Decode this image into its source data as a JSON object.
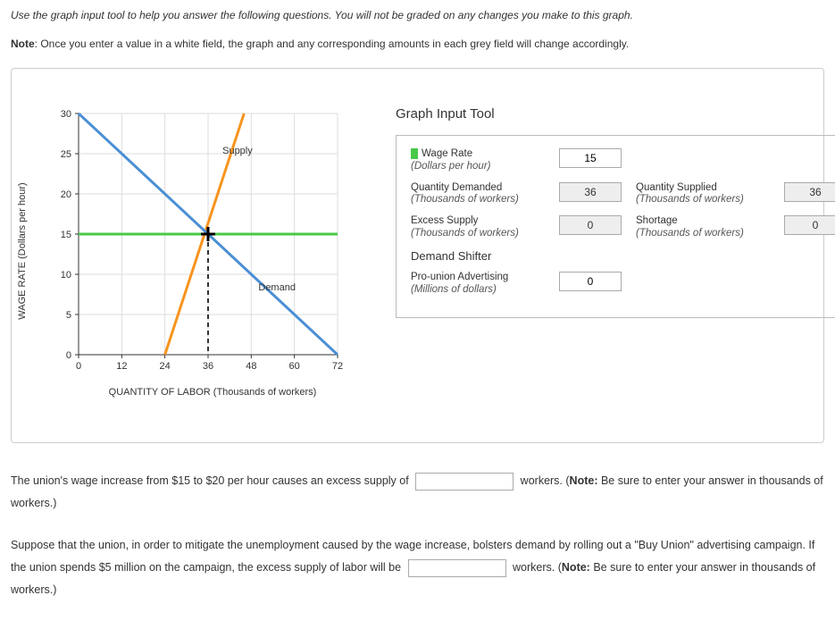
{
  "intro": "Use the graph input tool to help you answer the following questions. You will not be graded on any changes you make to this graph.",
  "note_prefix": "Note",
  "note_body": ": Once you enter a value in a white field, the graph and any corresponding amounts in each grey field will change accordingly.",
  "tool_title": "Graph Input Tool",
  "demand_shifter_heading": "Demand Shifter",
  "fields": {
    "wage_rate": {
      "label": "Wage Rate",
      "sub": "(Dollars per hour)",
      "value": "15"
    },
    "qty_demanded": {
      "label": "Quantity Demanded",
      "sub": "(Thousands of workers)",
      "value": "36"
    },
    "qty_supplied": {
      "label": "Quantity Supplied",
      "sub": "(Thousands of workers)",
      "value": "36"
    },
    "excess_supply": {
      "label": "Excess Supply",
      "sub": "(Thousands of workers)",
      "value": "0"
    },
    "shortage": {
      "label": "Shortage",
      "sub": "(Thousands of workers)",
      "value": "0"
    },
    "advertising": {
      "label": "Pro-union Advertising",
      "sub": "(Millions of dollars)",
      "value": "0"
    }
  },
  "q1": {
    "pre": "The union's wage increase from $15 to $20 per hour causes an excess supply of ",
    "post_a": " workers. (",
    "post_bold": "Note:",
    "post_b": " Be sure to enter your answer in thousands of workers.)"
  },
  "q2": {
    "pre": "Suppose that the union, in order to mitigate the unemployment caused by the wage increase, bolsters demand by rolling out a \"Buy Union\" advertising campaign. If the union spends $5 million on the campaign, the excess supply of labor will be ",
    "post_a": " workers. (",
    "post_bold": "Note:",
    "post_b": " Be sure to enter your answer in thousands of workers.)"
  },
  "chart_data": {
    "type": "line",
    "xlabel": "QUANTITY OF LABOR (Thousands of workers)",
    "ylabel": "WAGE RATE (Dollars per hour)",
    "xlim": [
      0,
      72
    ],
    "ylim": [
      0,
      30
    ],
    "xticks": [
      0,
      12,
      24,
      36,
      48,
      60,
      72
    ],
    "yticks": [
      0,
      5,
      10,
      15,
      20,
      25,
      30
    ],
    "series": [
      {
        "name": "Supply",
        "color": "#f7941d",
        "points": [
          [
            24,
            0
          ],
          [
            46,
            30
          ]
        ]
      },
      {
        "name": "Demand",
        "color": "#4a8fd4",
        "points": [
          [
            0,
            30
          ],
          [
            72,
            0
          ]
        ]
      },
      {
        "name": "WageLine",
        "color": "#49c949",
        "points": [
          [
            0,
            15
          ],
          [
            72,
            15
          ]
        ]
      }
    ],
    "indicator": {
      "x": 36,
      "y": 15
    },
    "labels": {
      "supply": "Supply",
      "demand": "Demand"
    }
  }
}
